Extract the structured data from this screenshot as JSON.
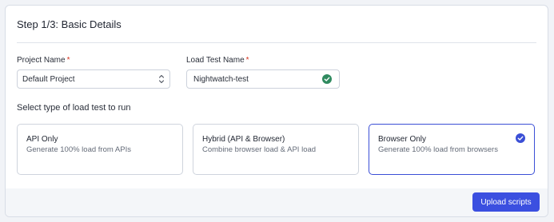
{
  "step": {
    "title": "Step 1/3: Basic Details"
  },
  "form": {
    "project_name_label": "Project Name",
    "project_name_value": "Default Project",
    "load_test_name_label": "Load Test Name",
    "load_test_name_value": "Nightwatch-test",
    "required_mark": "*"
  },
  "test_type": {
    "label": "Select type of load test to run",
    "selected": "Browser Only",
    "options": [
      {
        "title": "API Only",
        "description": "Generate 100% load from APIs"
      },
      {
        "title": "Hybrid (API & Browser)",
        "description": "Combine browser load & API load"
      },
      {
        "title": "Browser Only",
        "description": "Generate 100% load from browsers"
      }
    ]
  },
  "footer": {
    "upload_label": "Upload scripts"
  },
  "icons": {
    "select_chevron": "chevron-up-down-icon",
    "input_valid": "check-circle-icon",
    "option_selected": "check-circle-icon"
  },
  "colors": {
    "accent": "#3b4fe0",
    "valid_green": "#2f8a5f",
    "required_red": "#d6331f",
    "selected_border": "#3b4fd6"
  }
}
